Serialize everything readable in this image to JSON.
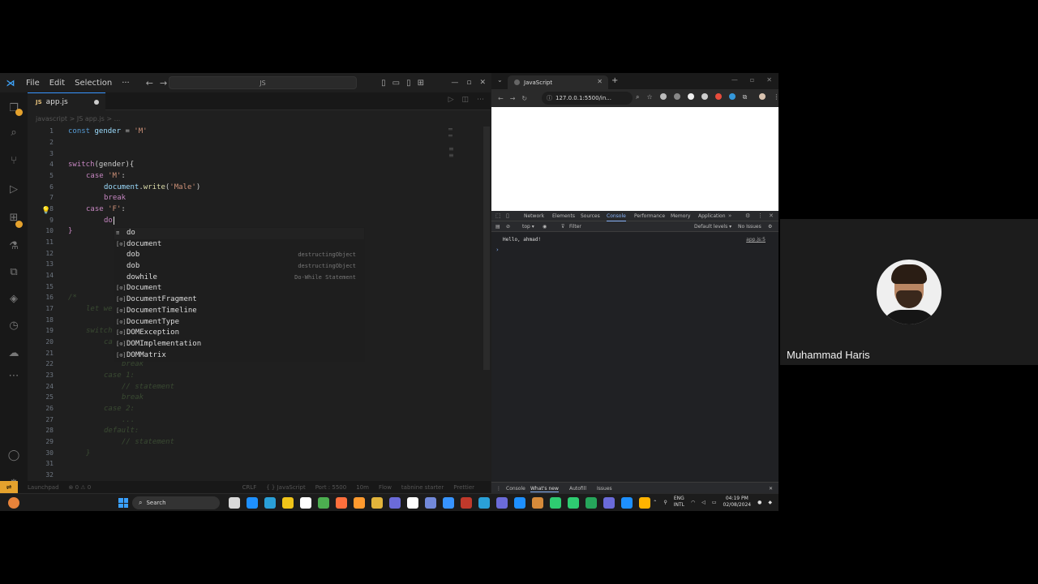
{
  "vscode": {
    "menu": [
      "File",
      "Edit",
      "Selection",
      "···"
    ],
    "command_center": "JS",
    "tab": {
      "filename": "app.js",
      "lang_badge": "JS"
    },
    "breadcrumb": "javascript  >  JS app.js  >  ...",
    "line_numbers": [
      "1",
      "2",
      "3",
      "4",
      "5",
      "6",
      "7",
      "8",
      "9",
      "10",
      "11",
      "12",
      "13",
      "14",
      "15",
      "16",
      "17",
      "18",
      "19",
      "20",
      "21",
      "22",
      "23",
      "24",
      "25",
      "26",
      "27",
      "28",
      "29",
      "30",
      "31",
      "32"
    ],
    "code": {
      "l1_const": "const",
      "l1_name": " gender ",
      "l1_eq": "= ",
      "l1_val": "'M'",
      "l4_switch": "switch",
      "l4_rest": "(gender){",
      "l5_case": "case",
      "l5_val": " 'M'",
      "l5_colon": ":",
      "l6_obj": "document",
      "l6_dot": ".",
      "l6_fn": "write",
      "l6_open": "(",
      "l6_arg": "'Male'",
      "l6_close": ")",
      "l7_break": "break",
      "l8_case": "case",
      "l8_val": " 'F'",
      "l8_colon": ":",
      "l9_typed": "do",
      "l10": "}",
      "l16": "/*",
      "l17": "let we",
      "l19": "switch",
      "l20": "ca",
      "l21": "",
      "l22": "break",
      "l23": "case 1:",
      "l24": "// statement",
      "l25": "break",
      "l26": "case 2:",
      "l27": "...",
      "l28": "default:",
      "l29": "// statement",
      "l30": "}"
    },
    "suggestions": [
      {
        "icon": "≡",
        "label": "do",
        "detail": ""
      },
      {
        "icon": "[⊙]",
        "label": "document",
        "detail": ""
      },
      {
        "icon": "",
        "label": "dob",
        "detail": "destructingObject"
      },
      {
        "icon": "",
        "label": "dob",
        "detail": "destructingObject"
      },
      {
        "icon": "",
        "label": "dowhile",
        "detail": "Do-While Statement"
      },
      {
        "icon": "[⊙]",
        "label": "Document",
        "detail": ""
      },
      {
        "icon": "[⊙]",
        "label": "DocumentFragment",
        "detail": ""
      },
      {
        "icon": "[⊙]",
        "label": "DocumentTimeline",
        "detail": ""
      },
      {
        "icon": "[⊙]",
        "label": "DocumentType",
        "detail": ""
      },
      {
        "icon": "[⊙]",
        "label": "DOMException",
        "detail": ""
      },
      {
        "icon": "[⊙]",
        "label": "DOMImplementation",
        "detail": ""
      },
      {
        "icon": "[⊙]",
        "label": "DOMMatrix",
        "detail": ""
      }
    ],
    "status": {
      "launchpad": "Launchpad",
      "errors": "⊗ 0 ⚠ 0",
      "warnings": "⚠ 0",
      "encoding": "CRLF",
      "language": "{ } JavaScript",
      "port": "Port : 5500",
      "time": "10m",
      "flow": "Flow",
      "tabnine": "tabnine starter",
      "prettier": "Prettier"
    }
  },
  "browser": {
    "tab_title": "JavaScript",
    "url": "127.0.0.1:5500/in...",
    "devtools_tabs": [
      "Network",
      "Elements",
      "Sources",
      "Console",
      "Performance",
      "Memory",
      "Application"
    ],
    "active_devtools_tab": "Console",
    "context": "top ▾",
    "filter_placeholder": "Filter",
    "levels": "Default levels ▾",
    "issues": "No Issues",
    "console_message": "Hello, ahmad!",
    "console_source": "app.js:5",
    "drawer_tabs": [
      "Console",
      "What's new",
      "Autofill",
      "Issues"
    ]
  },
  "taskbar": {
    "search": "Search",
    "lang_top": "ENG",
    "lang_bottom": "INTL",
    "time": "04:19 PM",
    "date": "02/08/2024",
    "app_colors": [
      "#d9d9d9",
      "#1e90ff",
      "#2aa0d8",
      "#f0c419",
      "#ffffff",
      "#4caf50",
      "#ff6f3c",
      "#ff9a2e",
      "#e2b43b",
      "#6b6bd9",
      "#ffffff",
      "#7289da",
      "#3794ff",
      "#c0392b",
      "#2aa0d8",
      "#6b6bd9",
      "#1e90ff",
      "#d68a3a",
      "#2ecc71",
      "#2ecc71",
      "#26a65b",
      "#6b6bd9",
      "#1e90ff",
      "#ffb300"
    ]
  },
  "participant": {
    "name": "Muhammad Haris"
  }
}
